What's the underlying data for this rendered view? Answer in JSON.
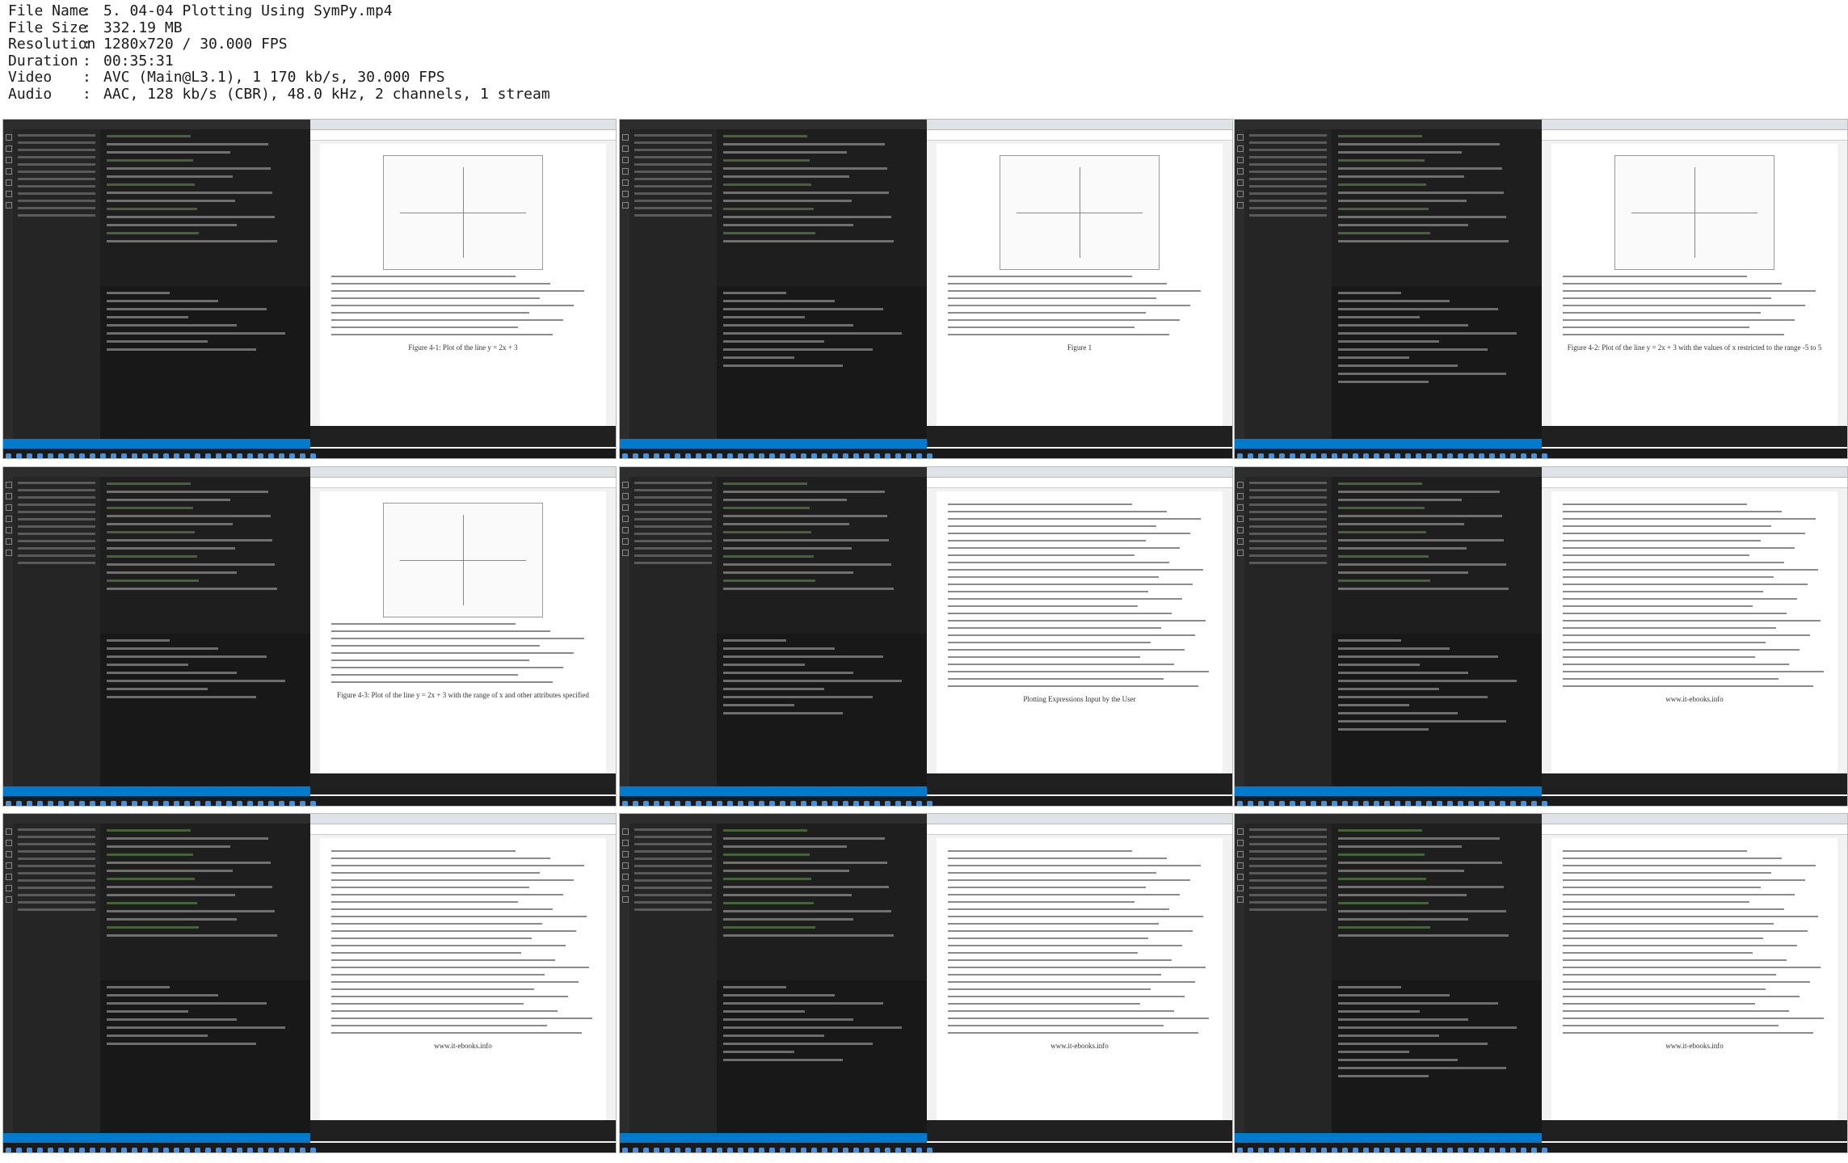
{
  "video_info": {
    "file_name_label": "File Name",
    "file_name": "5. 04-04 Plotting Using SymPy.mp4",
    "file_size_label": "File Size",
    "file_size": "332.19 MB",
    "resolution_label": "Resolution",
    "resolution": "1280x720 / 30.000 FPS",
    "duration_label": "Duration",
    "duration": "00:35:31",
    "video_label": "Video",
    "video": "AVC (Main@L3.1), 1 170 kb/s, 30.000 FPS",
    "audio_label": "Audio",
    "audio": "AAC, 128 kb/s (CBR), 48.0 kHz, 2 channels, 1 stream",
    "separator": ":"
  },
  "thumbnails": [
    {
      "caption": "Figure 4-1: Plot of the line y = 2x + 3"
    },
    {
      "caption": "Figure 1"
    },
    {
      "caption": "Figure 4-2: Plot of the line y = 2x + 3 with the values of x restricted to the range -5 to 5"
    },
    {
      "caption": "Figure 4-3: Plot of the line y = 2x + 3 with the range of x and other attributes specified"
    },
    {
      "caption": "Plotting Expressions Input by the User"
    },
    {
      "caption": "www.it-ebooks.info"
    },
    {
      "caption": "www.it-ebooks.info"
    },
    {
      "caption": "www.it-ebooks.info"
    },
    {
      "caption": "www.it-ebooks.info"
    }
  ]
}
